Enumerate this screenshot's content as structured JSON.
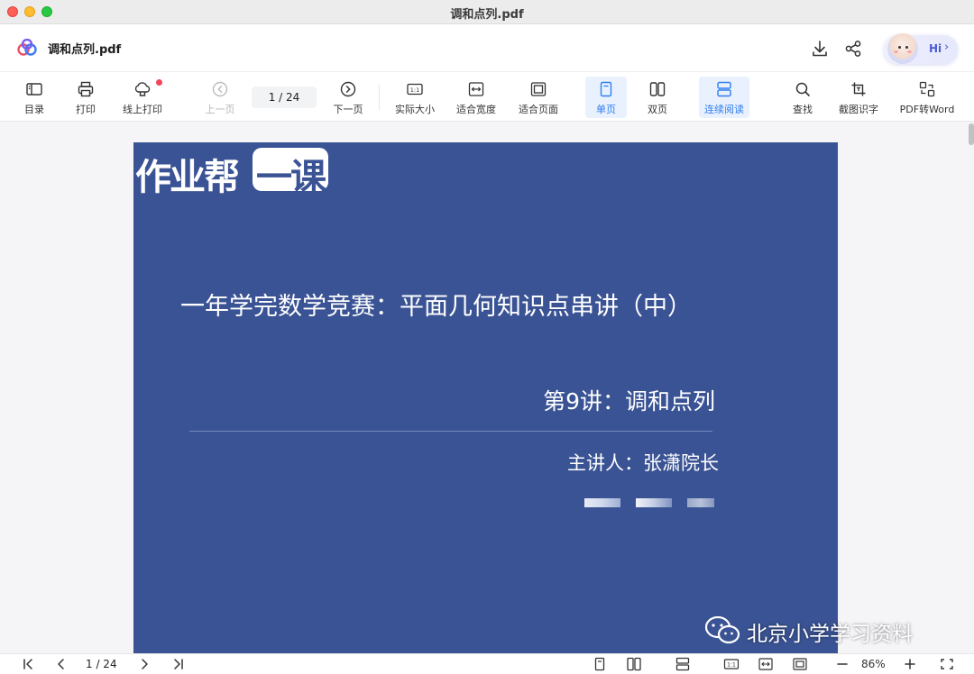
{
  "window": {
    "title": "调和点列.pdf"
  },
  "header": {
    "file_name": "调和点列.pdf",
    "hi_label": "Hi",
    "hi_chevron": "›"
  },
  "toolbar": {
    "toc": "目录",
    "print": "打印",
    "online_print": "线上打印",
    "prev_page": "上一页",
    "page_indicator": "1  /  24",
    "next_page": "下一页",
    "actual_size": "实际大小",
    "fit_width": "适合宽度",
    "fit_page": "适合页面",
    "single_page": "单页",
    "double_page": "双页",
    "continuous": "连续阅读",
    "find": "查找",
    "ocr": "截图识字",
    "pdf_to_word": "PDF转Word"
  },
  "document": {
    "brand_text": "作业帮",
    "brand_badge": "一课",
    "main_title": "一年学完数学竞赛：平面几何知识点串讲（中）",
    "lecture_title": "第9讲：调和点列",
    "speaker": "主讲人：张潇院长",
    "watermark": "北京小学学习资料"
  },
  "statusbar": {
    "page_indicator": "1 / 24",
    "zoom": "86%"
  },
  "colors": {
    "accent": "#2f7ef2",
    "slide_bg": "#3a5394",
    "notify_dot": "#f2455a"
  }
}
